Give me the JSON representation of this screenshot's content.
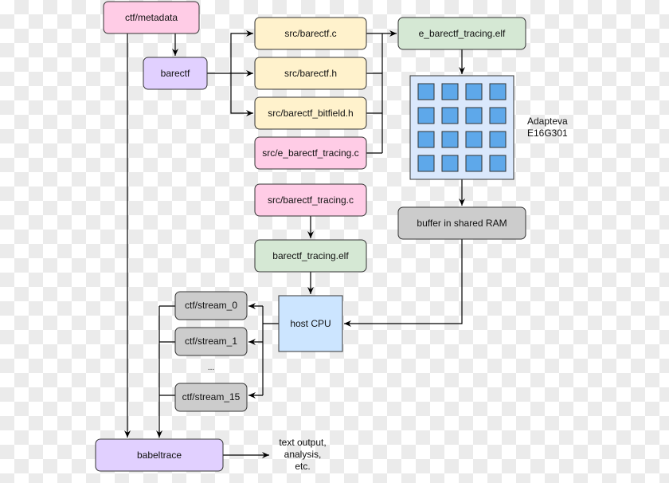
{
  "colors": {
    "pink": "#ffcce6",
    "purple": "#e1d0ff",
    "yellow": "#fff2cc",
    "green": "#d5e8d4",
    "blue": "#cce5ff",
    "gray": "#cccccc",
    "core": "#5ea8ea",
    "chip": "#dae8fc"
  },
  "nodes": {
    "metadata": "ctf/metadata",
    "barectf": "barectf",
    "src_c": "src/barectf.c",
    "src_h": "src/barectf.h",
    "src_bitfield": "src/barectf_bitfield.h",
    "src_e_tracing": "src/e_barectf_tracing.c",
    "e_elf": "e_barectf_tracing.elf",
    "chip_label_1": "Adapteva",
    "chip_label_2": "E16G301",
    "buffer": "buffer in shared RAM",
    "src_tracing": "src/barectf_tracing.c",
    "elf": "barectf_tracing.elf",
    "host": "host CPU",
    "stream0": "ctf/stream_0",
    "stream1": "ctf/stream_1",
    "ellipsis": "...",
    "stream15": "ctf/stream_15",
    "babeltrace": "babeltrace",
    "output_1": "text output,",
    "output_2": "analysis,",
    "output_3": "etc."
  }
}
